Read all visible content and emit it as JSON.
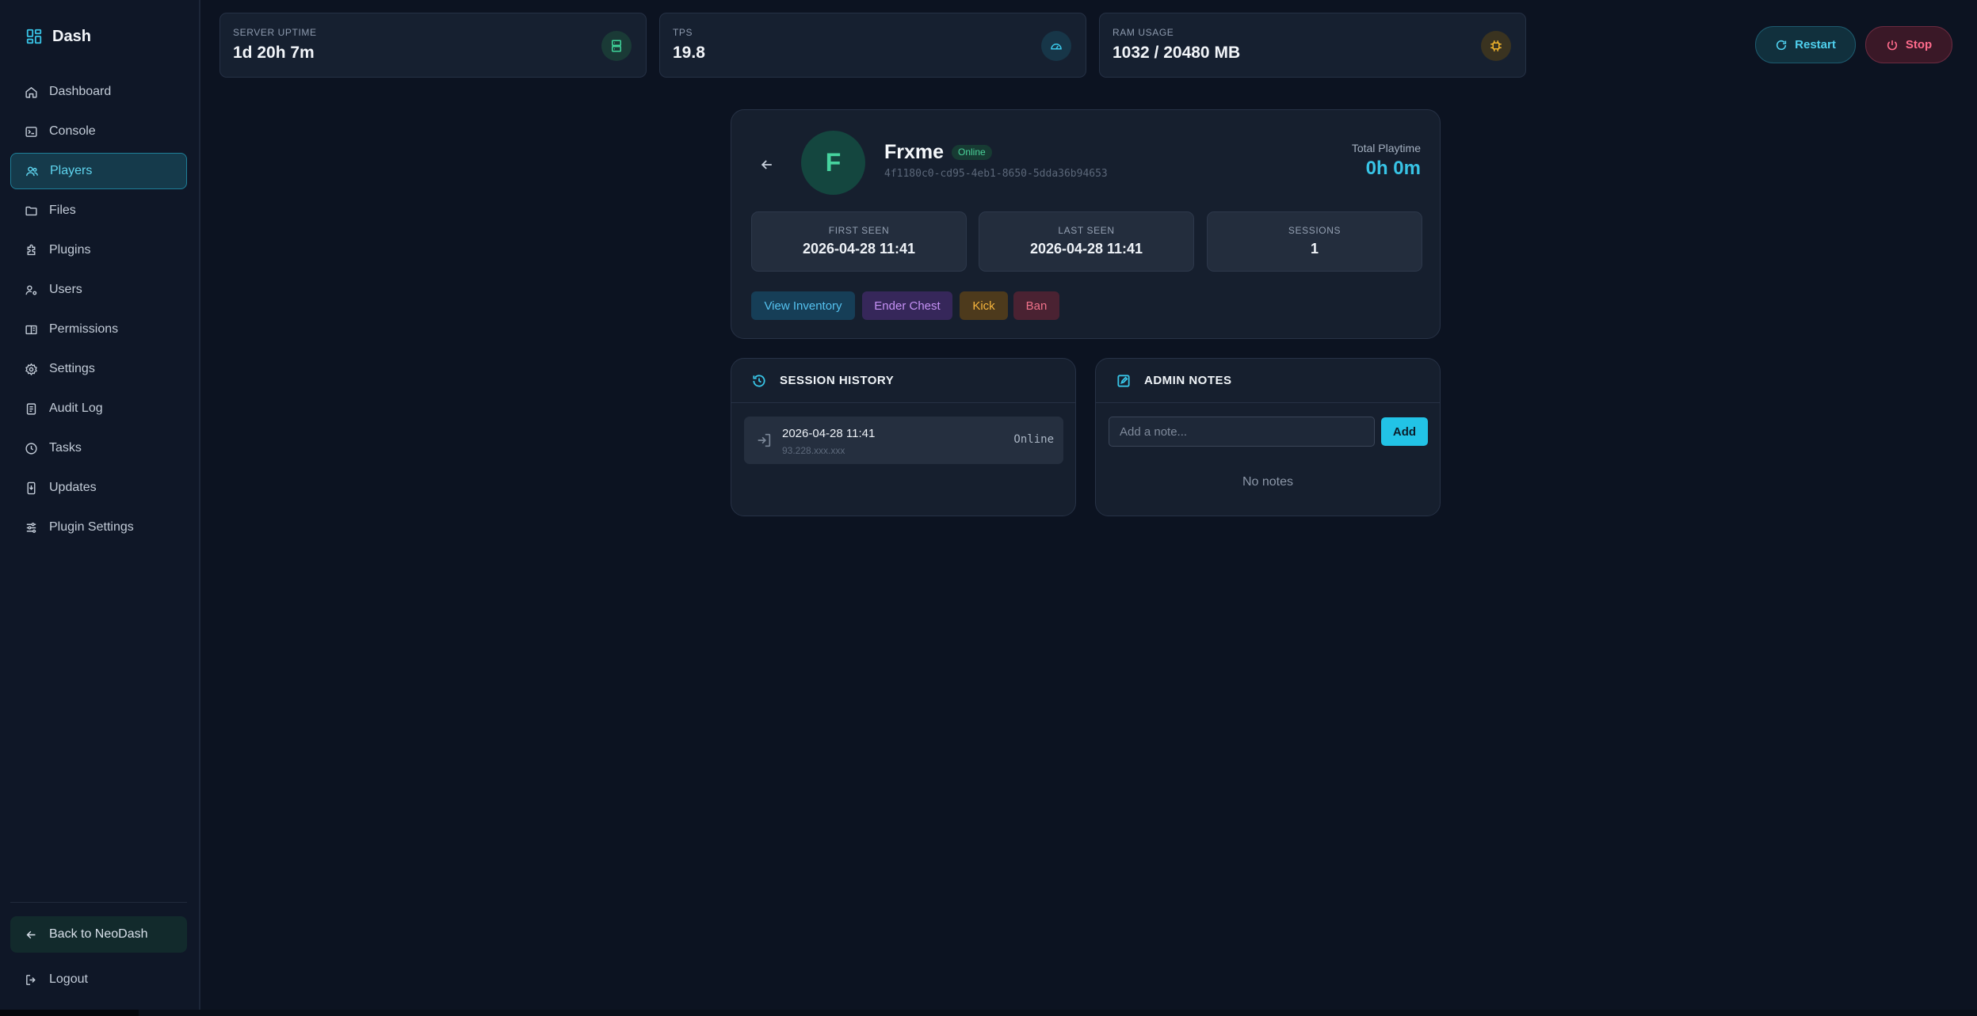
{
  "app": {
    "brand": "Dash"
  },
  "sidebar": {
    "items": [
      {
        "label": "Dashboard",
        "icon": "home-icon"
      },
      {
        "label": "Console",
        "icon": "terminal-icon"
      },
      {
        "label": "Players",
        "icon": "users-icon",
        "active": true
      },
      {
        "label": "Files",
        "icon": "folder-icon"
      },
      {
        "label": "Plugins",
        "icon": "puzzle-icon"
      },
      {
        "label": "Users",
        "icon": "user-cog-icon"
      },
      {
        "label": "Permissions",
        "icon": "permissions-icon"
      },
      {
        "label": "Settings",
        "icon": "gear-icon"
      },
      {
        "label": "Audit Log",
        "icon": "clipboard-icon"
      },
      {
        "label": "Tasks",
        "icon": "clock-icon"
      },
      {
        "label": "Updates",
        "icon": "update-icon"
      },
      {
        "label": "Plugin Settings",
        "icon": "sliders-icon"
      }
    ],
    "back_label": "Back to NeoDash",
    "logout_label": "Logout"
  },
  "stats": [
    {
      "label": "SERVER UPTIME",
      "value": "1d 20h 7m",
      "icon": "server-icon",
      "color": "#3fd49a"
    },
    {
      "label": "TPS",
      "value": "19.8",
      "icon": "gauge-icon",
      "color": "#3ac7e8"
    },
    {
      "label": "RAM USAGE",
      "value": "1032 / 20480 MB",
      "icon": "chip-icon",
      "color": "#f2b52c"
    }
  ],
  "controls": {
    "restart_label": "Restart",
    "stop_label": "Stop"
  },
  "player": {
    "initial": "F",
    "name": "Frxme",
    "status": "Online",
    "uuid": "4f1180c0-cd95-4eb1-8650-5dda36b94653",
    "playtime_label": "Total Playtime",
    "playtime_value": "0h 0m",
    "first_seen_label": "FIRST SEEN",
    "first_seen_value": "2026-04-28 11:41",
    "last_seen_label": "LAST SEEN",
    "last_seen_value": "2026-04-28 11:41",
    "sessions_label": "SESSIONS",
    "sessions_value": "1",
    "actions": {
      "inventory": "View Inventory",
      "ender": "Ender Chest",
      "kick": "Kick",
      "ban": "Ban"
    }
  },
  "session_history": {
    "title": "SESSION HISTORY",
    "entries": [
      {
        "time": "2026-04-28 11:41",
        "ip": "93.228.xxx.xxx",
        "status": "Online"
      }
    ]
  },
  "admin_notes": {
    "title": "ADMIN NOTES",
    "placeholder": "Add a note...",
    "add_label": "Add",
    "empty_text": "No notes"
  },
  "colors": {
    "accent": "#22c3e6",
    "online": "#4bd39a",
    "danger": "#ff6b8c"
  }
}
